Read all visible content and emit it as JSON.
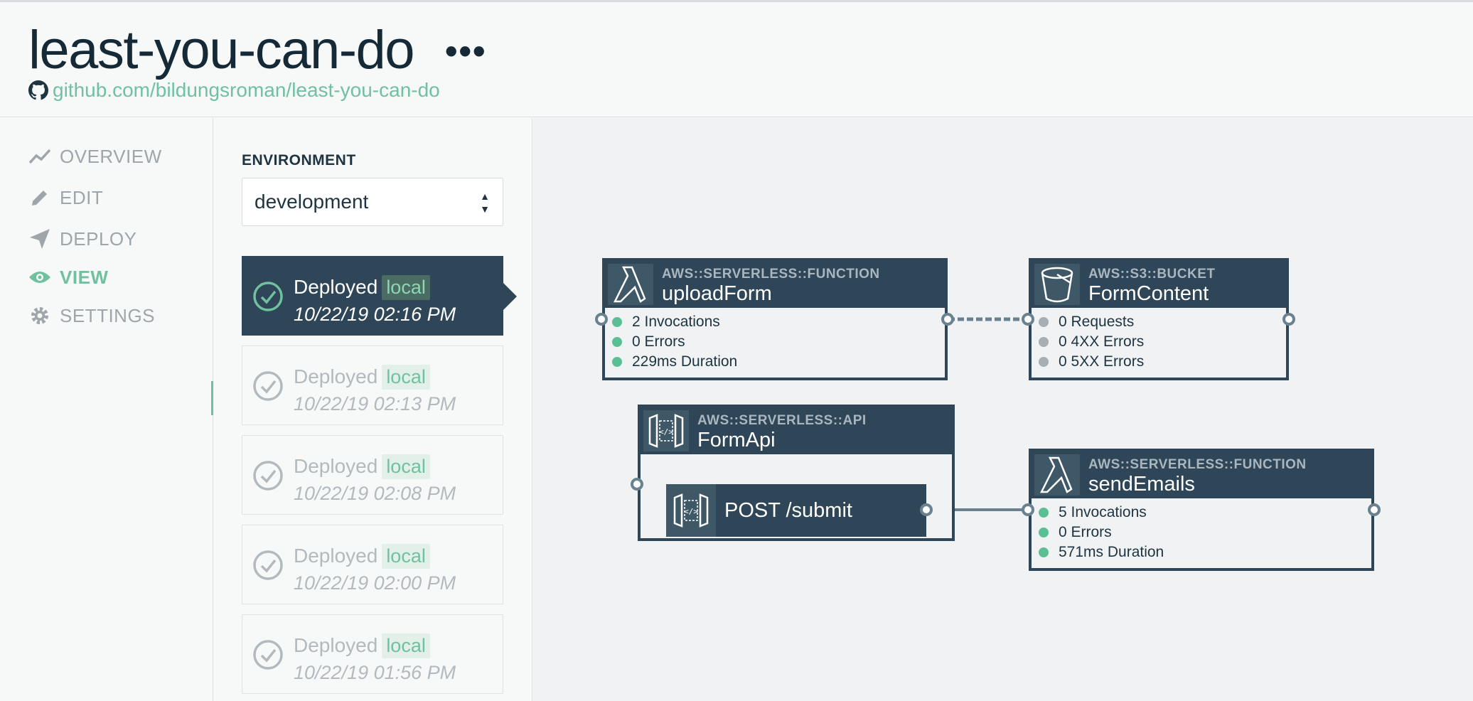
{
  "app": {
    "title": "least-you-can-do",
    "more_label": "•••",
    "repo": "github.com/bildungsroman/least-you-can-do"
  },
  "nav": {
    "items": [
      {
        "label": "OVERVIEW",
        "icon": "chart-line-icon",
        "active": false
      },
      {
        "label": "EDIT",
        "icon": "pencil-icon",
        "active": false
      },
      {
        "label": "DEPLOY",
        "icon": "paper-plane-icon",
        "active": false
      },
      {
        "label": "VIEW",
        "icon": "eye-icon",
        "active": true
      },
      {
        "label": "SETTINGS",
        "icon": "gear-icon",
        "active": false
      }
    ]
  },
  "environment": {
    "label": "ENVIRONMENT",
    "selected": "development"
  },
  "deployments": [
    {
      "status": "Deployed",
      "tag": "local",
      "time": "10/22/19 02:16 PM",
      "active": true
    },
    {
      "status": "Deployed",
      "tag": "local",
      "time": "10/22/19 02:13 PM",
      "active": false
    },
    {
      "status": "Deployed",
      "tag": "local",
      "time": "10/22/19 02:08 PM",
      "active": false
    },
    {
      "status": "Deployed",
      "tag": "local",
      "time": "10/22/19 02:00 PM",
      "active": false
    },
    {
      "status": "Deployed",
      "tag": "local",
      "time": "10/22/19 01:56 PM",
      "active": false
    }
  ],
  "diagram": {
    "upload_form": {
      "type": "AWS::SERVERLESS::FUNCTION",
      "name": "uploadForm",
      "icon": "lambda-icon",
      "metrics": [
        "2 Invocations",
        "0 Errors",
        "229ms Duration"
      ]
    },
    "form_content": {
      "type": "AWS::S3::BUCKET",
      "name": "FormContent",
      "icon": "bucket-icon",
      "metrics": [
        "0 Requests",
        "0 4XX Errors",
        "0 5XX Errors"
      ]
    },
    "form_api": {
      "type": "AWS::SERVERLESS::API",
      "name": "FormApi",
      "icon": "api-gateway-icon",
      "route": "POST /submit"
    },
    "send_emails": {
      "type": "AWS::SERVERLESS::FUNCTION",
      "name": "sendEmails",
      "icon": "lambda-icon",
      "metrics": [
        "5 Invocations",
        "0 Errors",
        "571ms Duration"
      ]
    }
  },
  "colors": {
    "accent": "#6fc1a0",
    "node_dark": "#2e4657",
    "metric_active": "#5bbf96",
    "metric_idle": "#a7afb4"
  }
}
